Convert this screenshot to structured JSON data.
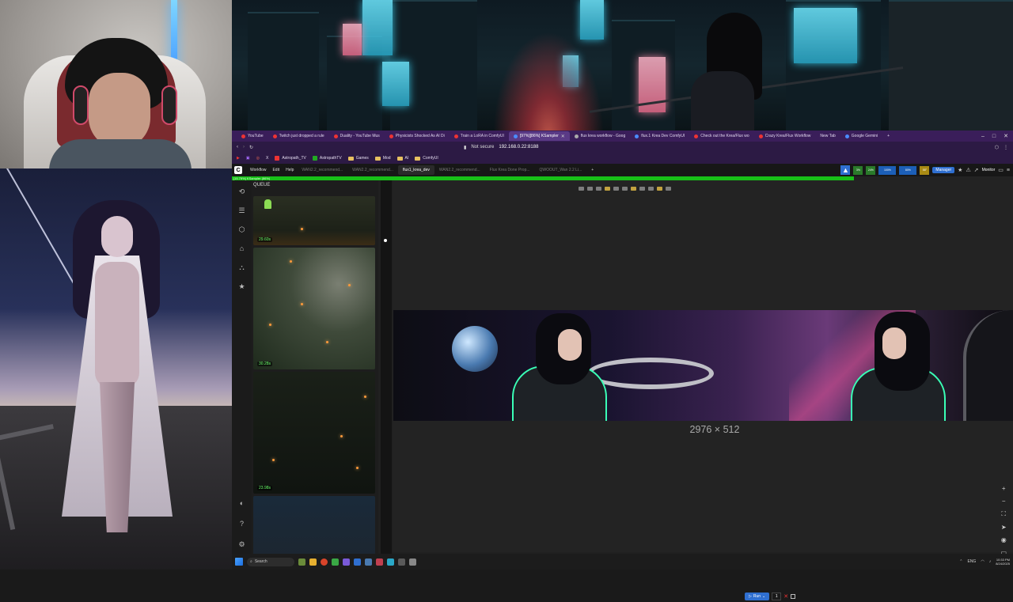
{
  "browser": {
    "tabs": [
      {
        "label": "YouTube",
        "icon": "youtube-icon"
      },
      {
        "label": "Twitch just dropped a rule",
        "icon": "youtube-icon"
      },
      {
        "label": "Duality - YouTube Mus",
        "icon": "youtube-icon"
      },
      {
        "label": "Physicists Shocked As AI Di",
        "icon": "youtube-icon"
      },
      {
        "label": "Train a LoRA in ComfyUI",
        "icon": "youtube-icon"
      },
      {
        "label": "[97%][86%] KSampler",
        "icon": "comfy-icon",
        "active": true
      },
      {
        "label": "flux krea workflow - Goog",
        "icon": "google-icon"
      },
      {
        "label": "flux.1 Krea Dev ComfyUI",
        "icon": "comfy-icon"
      },
      {
        "label": "Check out the Krea/Flux wo",
        "icon": "youtube-icon"
      },
      {
        "label": "Crazy Krea/Flux Workflow",
        "icon": "youtube-icon"
      },
      {
        "label": "New Tab",
        "icon": ""
      },
      {
        "label": "Google Gemini",
        "icon": "gemini-icon"
      }
    ],
    "new_tab": "+",
    "window_controls": [
      "–",
      "□",
      "✕"
    ],
    "security_label": "Not secure",
    "url": "192.168.0.22:8188",
    "bookmarks": [
      {
        "label": "Astropath_TV",
        "type": "site"
      },
      {
        "label": "AstropathTV",
        "type": "site"
      },
      {
        "label": "Games",
        "type": "folder"
      },
      {
        "label": "Mod",
        "type": "folder"
      },
      {
        "label": "AI",
        "type": "folder"
      },
      {
        "label": "ComfyUI",
        "type": "site"
      }
    ]
  },
  "comfy": {
    "menu": [
      "Workflow",
      "Edit",
      "Help"
    ],
    "workflow_tabs": [
      {
        "label": "WAN2.2_recommend...",
        "active": false
      },
      {
        "label": "WAN2.2_recommend...",
        "active": false
      },
      {
        "label": "flux1_krea_dev",
        "active": true
      },
      {
        "label": "WAN2.2_recommend...",
        "active": false
      },
      {
        "label": "Flux Krea Done Prop...",
        "active": false
      },
      {
        "label": "QWOOUT_Wan 2.2 Li...",
        "active": false
      }
    ],
    "add_tab": "+",
    "stats": [
      {
        "label": "CPU",
        "value": "3%"
      },
      {
        "label": "RAM",
        "value": "24%"
      },
      {
        "label": "GPU",
        "value": "100%"
      },
      {
        "label": "VRAM",
        "value": "80%"
      },
      {
        "label": "Temp",
        "value": "58°"
      }
    ],
    "manager_label": "Manager",
    "monitor_label": "Monitor",
    "progress": {
      "label": "[15.79%] KSampler (86%)",
      "fraction": 0.796
    },
    "queue": {
      "title": "QUEUE",
      "items": [
        {
          "time": "29.60s"
        },
        {
          "time": "30.28s"
        },
        {
          "time": "23.98s"
        },
        {
          "time": ""
        }
      ]
    },
    "preview_dimensions": "2976 × 512",
    "run": {
      "label": "Run",
      "count": "1"
    }
  },
  "taskbar": {
    "search_placeholder": "Search",
    "lang": "ENG",
    "time": "10:33 PM",
    "date": "8/24/2025"
  },
  "colors": {
    "browser_chrome": "#3a1e5a",
    "progress": "#18c018",
    "accent_blue": "#2f6fd0",
    "queue_time": "#6cff6c"
  }
}
